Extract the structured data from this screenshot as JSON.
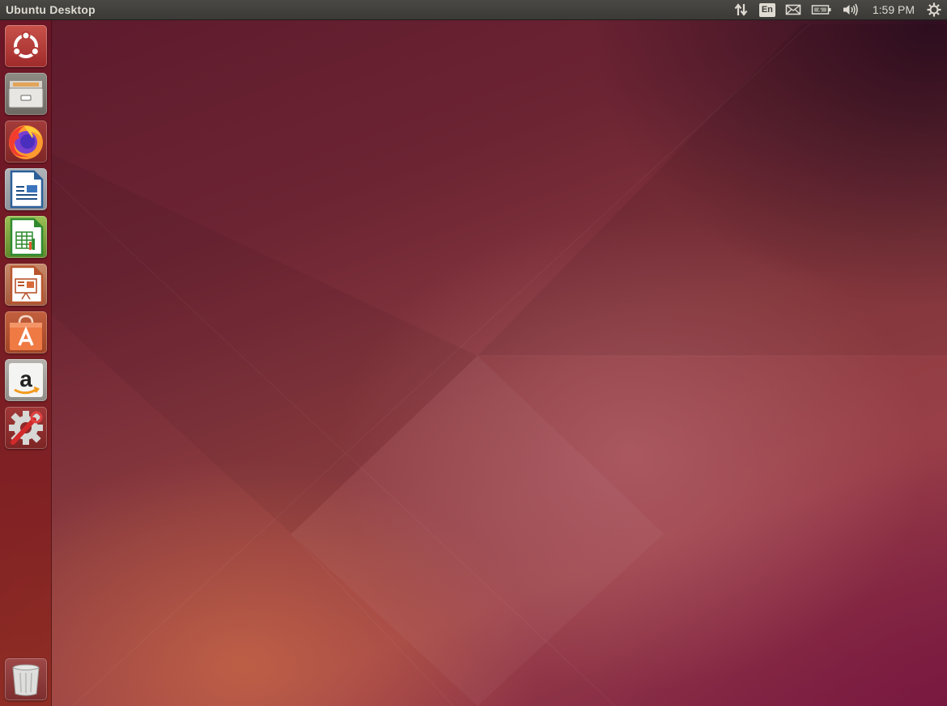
{
  "top_panel": {
    "title": "Ubuntu Desktop",
    "keyboard_layout": "En",
    "clock": "1:59 PM",
    "indicators": [
      "network-icon",
      "keyboard-layout-indicator",
      "mail-icon",
      "battery-icon",
      "volume-icon",
      "clock",
      "system-gear-icon"
    ]
  },
  "launcher": {
    "items": [
      {
        "name": "dash-home",
        "icon": "ubuntu-logo-icon"
      },
      {
        "name": "files",
        "icon": "file-cabinet-icon"
      },
      {
        "name": "firefox",
        "icon": "firefox-icon"
      },
      {
        "name": "libreoffice-writer",
        "icon": "writer-document-icon"
      },
      {
        "name": "libreoffice-calc",
        "icon": "calc-spreadsheet-icon"
      },
      {
        "name": "libreoffice-impress",
        "icon": "impress-presentation-icon"
      },
      {
        "name": "ubuntu-software",
        "icon": "shopping-bag-a-icon"
      },
      {
        "name": "amazon",
        "icon": "amazon-logo-icon"
      },
      {
        "name": "system-settings",
        "icon": "gear-wrench-icon"
      },
      {
        "name": "trash",
        "icon": "trash-bin-icon"
      }
    ]
  },
  "colors": {
    "panel": "#3c3b37",
    "panel_text": "#dfdbd2",
    "wallpaper_dark": "#5c1a2c",
    "wallpaper_orange": "#c0604a",
    "ubuntu_orange": "#e95420"
  }
}
